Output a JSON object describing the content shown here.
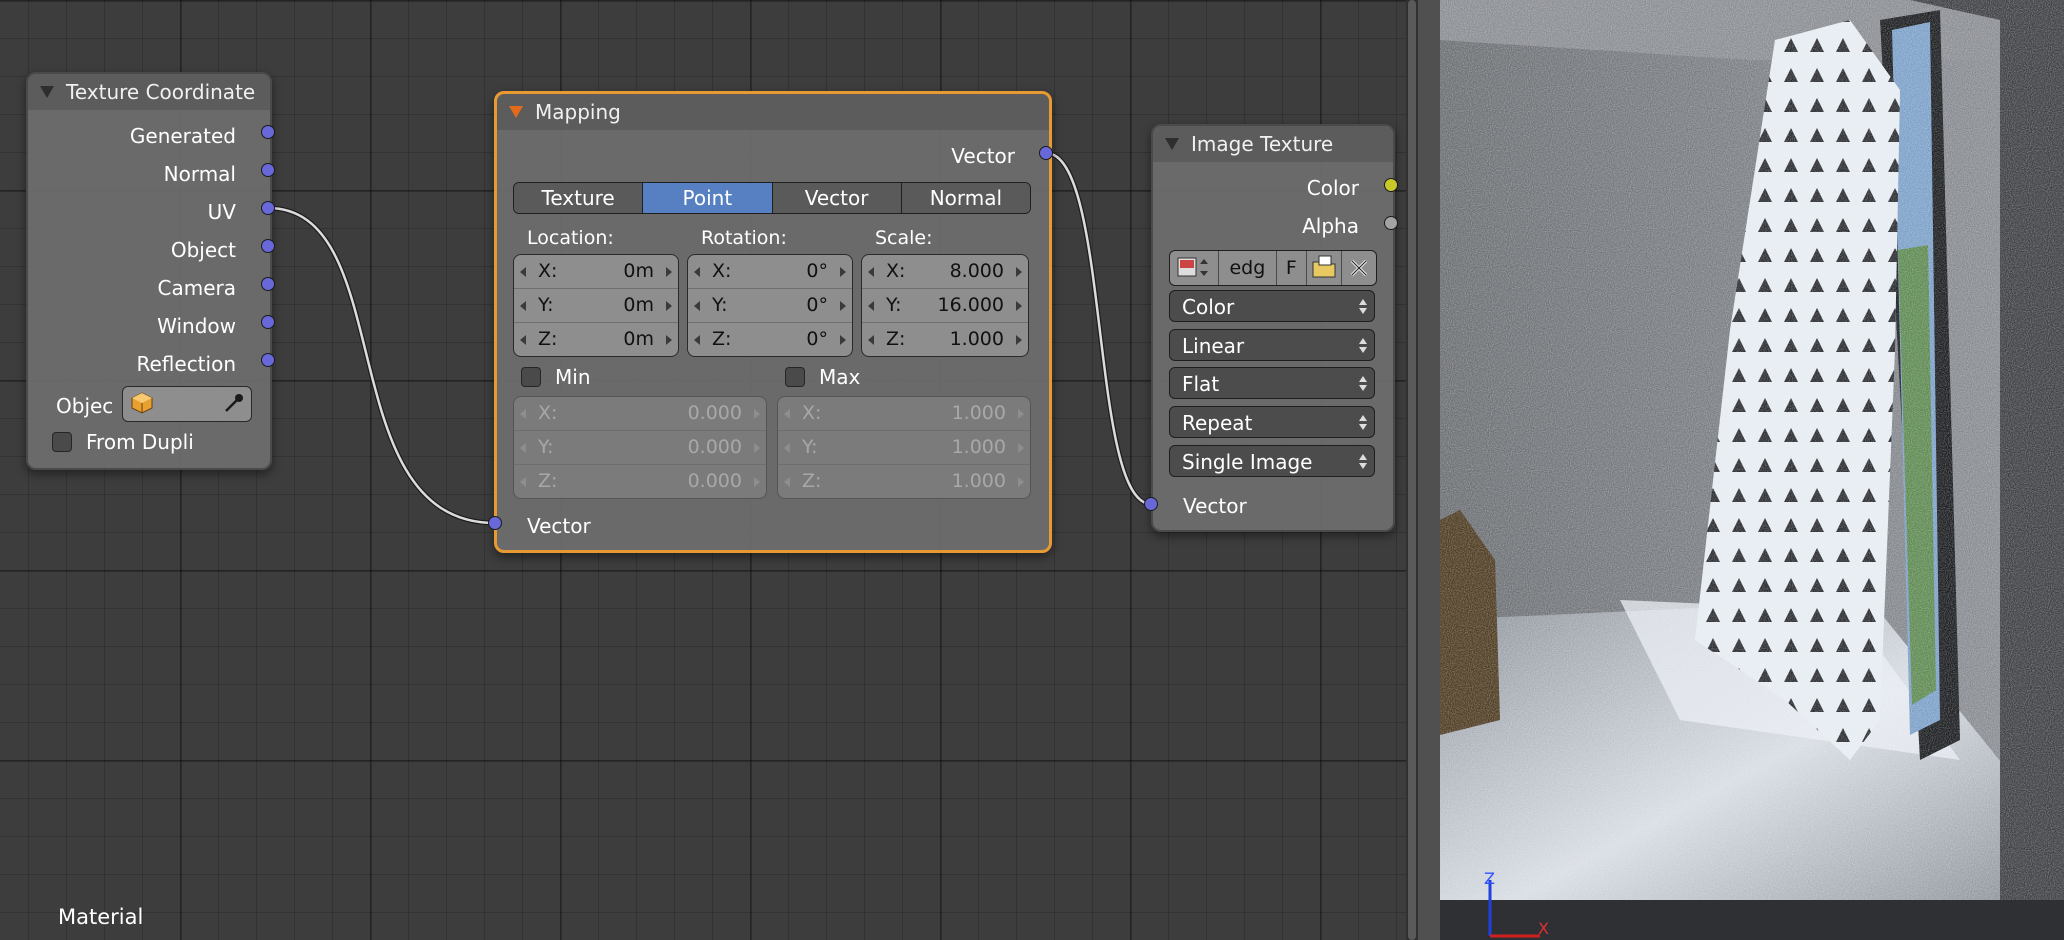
{
  "texture_coordinate": {
    "title": "Texture Coordinate",
    "outputs": [
      "Generated",
      "Normal",
      "UV",
      "Object",
      "Camera",
      "Window",
      "Reflection"
    ],
    "object_label": "Objec",
    "object_icon": "cube-icon",
    "eyedropper_icon": "eyedropper-icon",
    "from_dupli_label": "From Dupli",
    "from_dupli_checked": false
  },
  "mapping": {
    "title": "Mapping",
    "output_label": "Vector",
    "input_label": "Vector",
    "types": [
      "Texture",
      "Point",
      "Vector",
      "Normal"
    ],
    "selected_type": "Point",
    "location": {
      "label": "Location:",
      "x_label": "X:",
      "x": "0m",
      "y_label": "Y:",
      "y": "0m",
      "z_label": "Z:",
      "z": "0m"
    },
    "rotation": {
      "label": "Rotation:",
      "x_label": "X:",
      "x": "0°",
      "y_label": "Y:",
      "y": "0°",
      "z_label": "Z:",
      "z": "0°"
    },
    "scale": {
      "label": "Scale:",
      "x_label": "X:",
      "x": "8.000",
      "y_label": "Y:",
      "y": "16.000",
      "z_label": "Z:",
      "z": "1.000"
    },
    "min": {
      "label": "Min",
      "checked": false,
      "x_label": "X:",
      "x": "0.000",
      "y_label": "Y:",
      "y": "0.000",
      "z_label": "Z:",
      "z": "0.000"
    },
    "max": {
      "label": "Max",
      "checked": false,
      "x_label": "X:",
      "x": "1.000",
      "y_label": "Y:",
      "y": "1.000",
      "z_label": "Z:",
      "z": "1.000"
    }
  },
  "image_texture": {
    "title": "Image Texture",
    "outputs": [
      "Color",
      "Alpha"
    ],
    "input_label": "Vector",
    "image_name": "edg",
    "fake_user_label": "F",
    "color_space": "Color",
    "interpolation": "Linear",
    "projection": "Flat",
    "extension": "Repeat",
    "source": "Single Image"
  },
  "editor": {
    "context_label": "Material"
  },
  "colors": {
    "active_node_border": "#e89a32",
    "vector_socket": "#6868d8",
    "color_socket": "#c8c82a",
    "selected_button": "#5680c2"
  }
}
